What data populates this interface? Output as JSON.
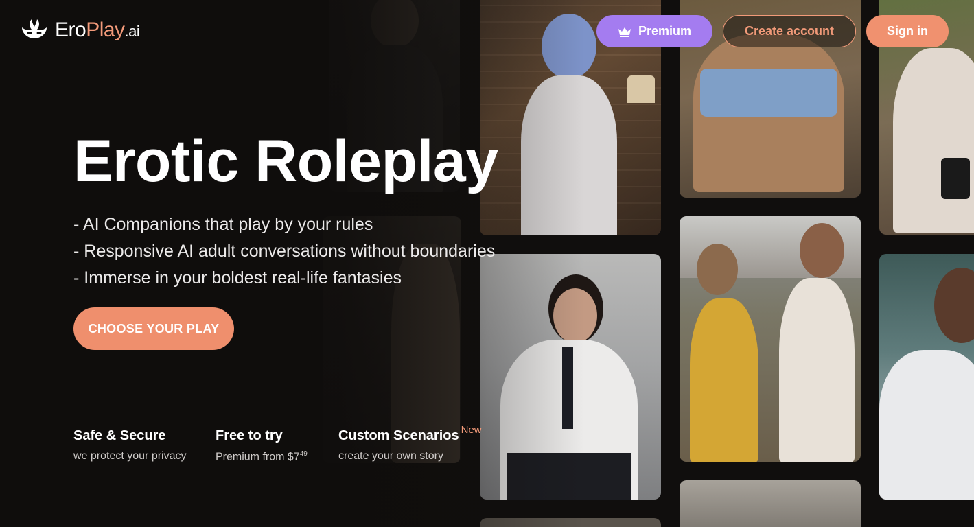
{
  "header": {
    "logo": {
      "part1": "Ero",
      "part2": "Play",
      "part3": ".ai"
    },
    "premium_label": "Premium",
    "create_account_label": "Create account",
    "sign_in_label": "Sign in"
  },
  "hero": {
    "title": "Erotic Roleplay",
    "bullets": [
      "- AI Companions that play by your rules",
      "- Responsive AI adult conversations without boundaries",
      "- Immerse in your boldest real-life fantasies"
    ],
    "cta_label": "CHOOSE YOUR PLAY"
  },
  "features": [
    {
      "title": "Safe & Secure",
      "subtitle": "we protect your privacy"
    },
    {
      "title": "Free to try",
      "subtitle": "Premium from $7",
      "price_cents": "49"
    },
    {
      "title": "Custom Scenarios",
      "badge": "New",
      "subtitle": "create your own story"
    }
  ],
  "colors": {
    "accent": "#f0916f",
    "premium": "#a47cf0",
    "background": "#100e0d"
  },
  "icons": [
    "logo-mask-icon",
    "crown-icon"
  ]
}
